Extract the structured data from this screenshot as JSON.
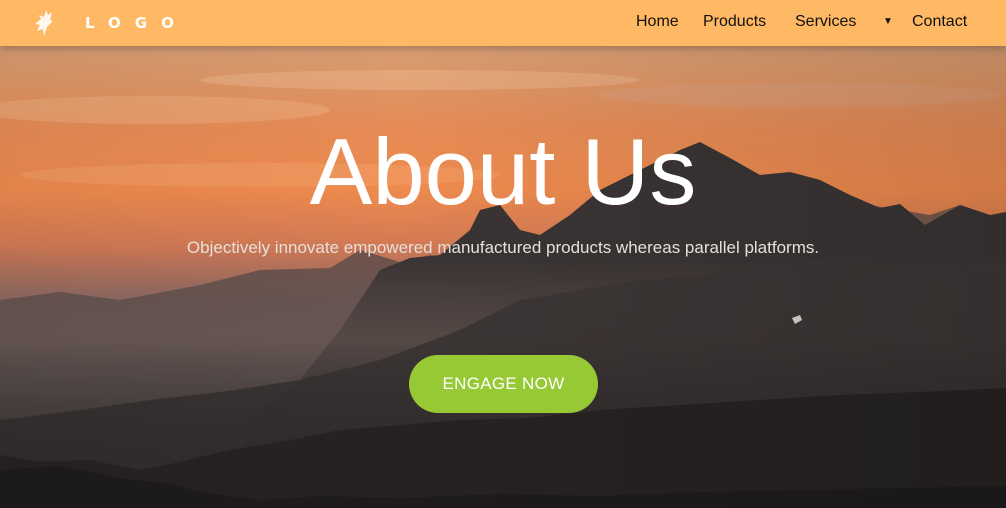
{
  "navbar": {
    "logo_text": "LOGO",
    "logo_icon": "leaf-feather-icon",
    "background_color": "#ffb964",
    "items": [
      {
        "label": "Home"
      },
      {
        "label": "Products"
      },
      {
        "label": "Services"
      },
      {
        "label": "Contact"
      }
    ],
    "dropdown_caret": "▼"
  },
  "hero": {
    "title": "About Us",
    "subtitle": "Objectively innovate empowered manufactured products whereas parallel platforms.",
    "cta_label": "ENGAGE NOW",
    "cta_color": "#97c934"
  }
}
